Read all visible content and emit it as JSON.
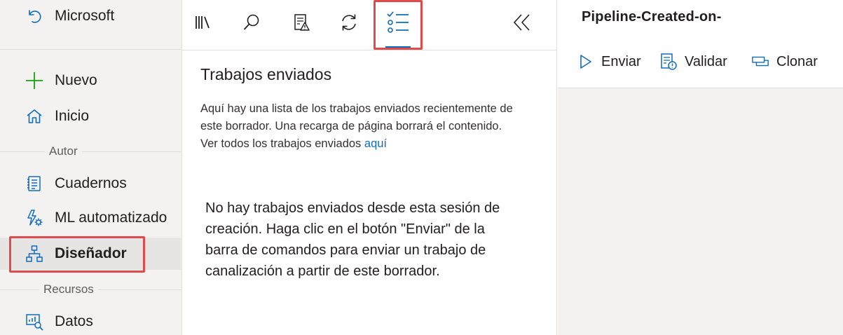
{
  "colors": {
    "accent": "#0f6cbd",
    "highlight": "#e04a4a",
    "nav_bg": "#f3f2f1",
    "active_bg": "#e6e5e3"
  },
  "leftnav": {
    "back_label": "Microsoft",
    "items": [
      {
        "label": "Nuevo",
        "icon": "plus-icon"
      },
      {
        "label": "Inicio",
        "icon": "home-icon"
      },
      {
        "label": "Cuadernos",
        "icon": "notebook-icon"
      },
      {
        "label": "ML automatizado",
        "icon": "automated-ml-icon"
      },
      {
        "label": "Diseñador",
        "icon": "designer-icon",
        "active": true
      },
      {
        "label": "Datos",
        "icon": "data-icon"
      }
    ],
    "sections": {
      "author": "Autor",
      "resources": "Recursos"
    }
  },
  "toolbar": {
    "buttons": [
      {
        "icon": "library-icon"
      },
      {
        "icon": "search-icon"
      },
      {
        "icon": "validate-icon"
      },
      {
        "icon": "refresh-icon"
      },
      {
        "icon": "submitted-jobs-icon",
        "active": true
      }
    ],
    "collapse_icon": "double-chevron-left-icon"
  },
  "panel": {
    "title": "Trabajos enviados",
    "desc_line1": "Aquí hay una lista de los trabajos enviados recientemente de",
    "desc_line2": "este borrador. Una recarga de página borrará el contenido.",
    "desc_line3_prefix": "Ver todos los trabajos enviados",
    "desc_link": "aquí",
    "empty_line1": "No hay trabajos enviados desde esta sesión de",
    "empty_line2": "creación. Haga clic en el botón \"Enviar\" de la",
    "empty_line3": "barra de comandos para enviar un trabajo de",
    "empty_line4": "canalización a partir de este borrador."
  },
  "pipeline": {
    "title": "Pipeline-Created-on-",
    "commands": [
      {
        "label": "Enviar",
        "icon": "play-icon"
      },
      {
        "label": "Validar",
        "icon": "validate-doc-icon"
      },
      {
        "label": "Clonar",
        "icon": "clone-icon"
      }
    ]
  }
}
